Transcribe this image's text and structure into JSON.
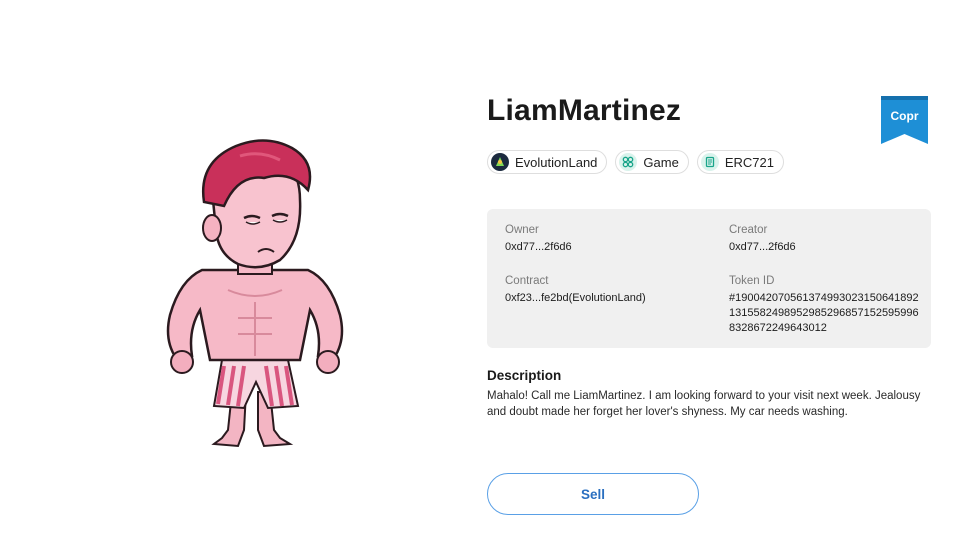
{
  "nft": {
    "name": "LiamMartinez",
    "badge_label": "Copr",
    "badge_color": "#1e8fd6",
    "image_alt": "muscular cartoon character in pink striped shorts"
  },
  "tags": [
    {
      "label": "EvolutionLand",
      "icon": "evolutionland-logo-icon"
    },
    {
      "label": "Game",
      "icon": "game-icon"
    },
    {
      "label": "ERC721",
      "icon": "erc721-document-icon"
    }
  ],
  "info": {
    "owner_label": "Owner",
    "owner_value": "0xd77...2f6d6",
    "creator_label": "Creator",
    "creator_value": "0xd77...2f6d6",
    "contract_label": "Contract",
    "contract_value": "0xf23...fe2bd(EvolutionLand)",
    "token_label": "Token ID",
    "token_value": "#1900420705613749930231506418921315582498952985296857152595996832867224964301​2"
  },
  "description": {
    "heading": "Description",
    "text": "Mahalo! Call me LiamMartinez. I am looking forward to your visit next week. Jealousy and doubt made her forget her lover's shyness. My car needs washing."
  },
  "actions": {
    "sell_label": "Sell"
  },
  "colors": {
    "accent": "#2a6fc0",
    "panel": "#f0f0f0",
    "badge": "#1e8fd6"
  }
}
